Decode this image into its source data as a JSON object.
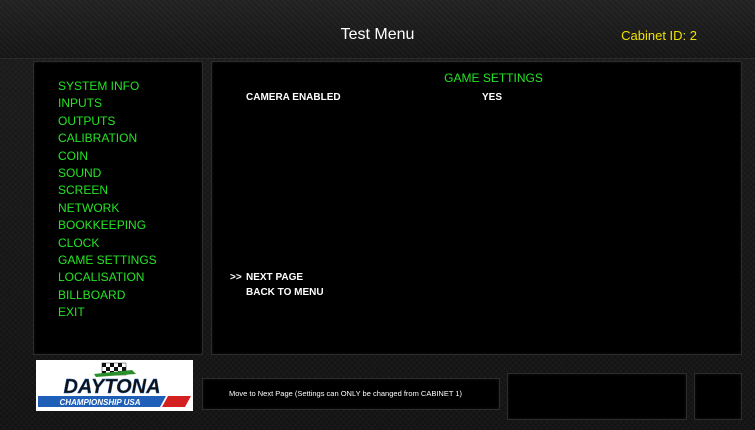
{
  "header": {
    "title": "Test Menu",
    "cabinet_id": "Cabinet ID: 2"
  },
  "sidebar": {
    "items": [
      {
        "label": "SYSTEM INFO"
      },
      {
        "label": "INPUTS"
      },
      {
        "label": "OUTPUTS"
      },
      {
        "label": "CALIBRATION"
      },
      {
        "label": "COIN"
      },
      {
        "label": "SOUND"
      },
      {
        "label": "SCREEN"
      },
      {
        "label": "NETWORK"
      },
      {
        "label": "BOOKKEEPING"
      },
      {
        "label": "CLOCK"
      },
      {
        "label": "GAME SETTINGS"
      },
      {
        "label": "LOCALISATION"
      },
      {
        "label": "BILLBOARD"
      },
      {
        "label": "EXIT"
      }
    ]
  },
  "content": {
    "section_title": "GAME SETTINGS",
    "settings": [
      {
        "label": "CAMERA ENABLED",
        "value": "YES"
      }
    ],
    "nav": {
      "cursor": ">>",
      "next_page": "NEXT PAGE",
      "back_to_menu": "BACK TO MENU"
    }
  },
  "logo": {
    "brand": "DAYTONA",
    "subtitle": "CHAMPIONSHIP USA"
  },
  "status_bar": {
    "text": "Move to Next Page (Settings can ONLY be changed from CABINET 1)"
  },
  "colors": {
    "menu_green": "#25e425",
    "cabinet_yellow": "#f0e200",
    "panel_black": "#000000",
    "logo_blue": "#1f5fb8",
    "logo_red": "#d42020"
  }
}
